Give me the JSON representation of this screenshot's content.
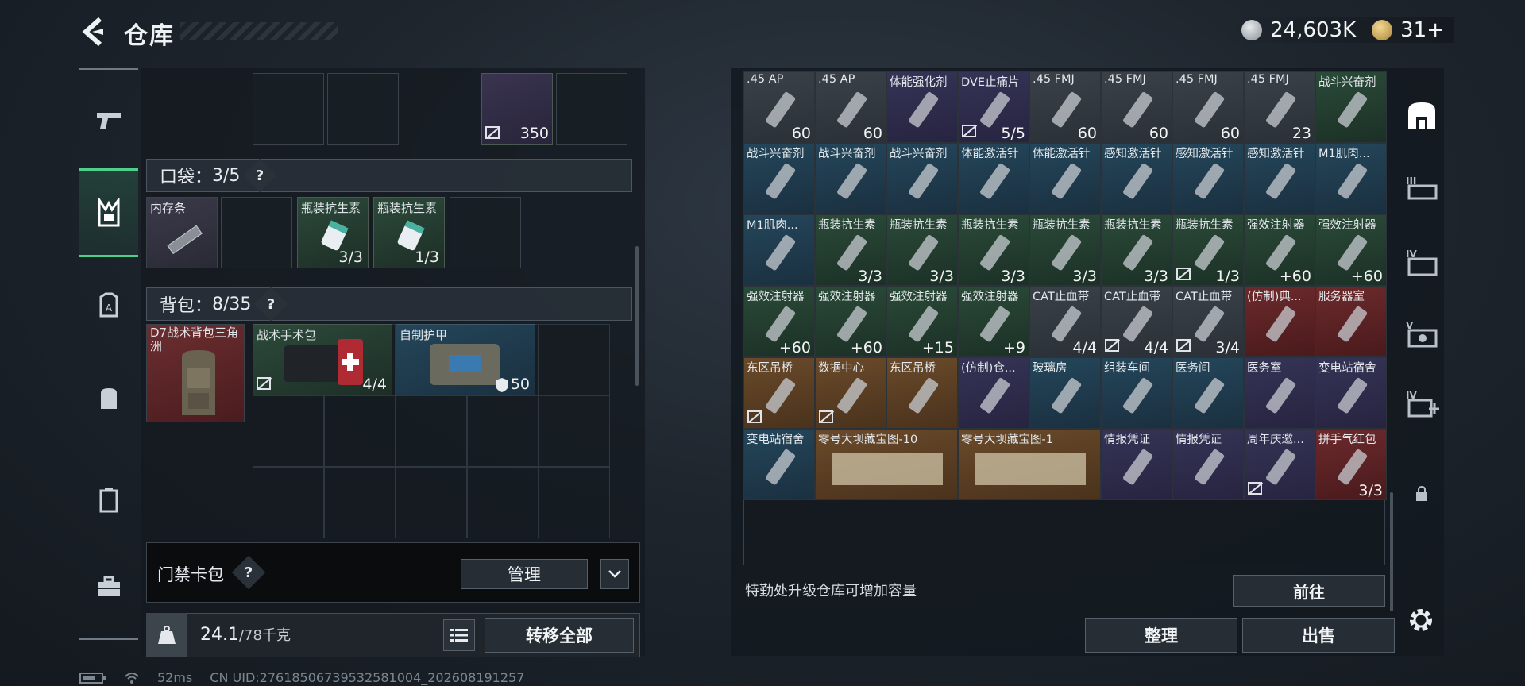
{
  "header": {
    "title": "仓库",
    "currency_1": "24,603K",
    "currency_2": "31+"
  },
  "left_nav": {
    "items": [
      "weapon-icon",
      "vest-icon",
      "armor-icon",
      "backpack-icon",
      "case-icon",
      "toolbox-icon"
    ]
  },
  "left_panel": {
    "top_slot_count": "350",
    "pocket": {
      "label": "口袋：",
      "used": "3",
      "total": "/5",
      "help": "?"
    },
    "pocket_items": [
      {
        "name": "内存条",
        "count": ""
      },
      {
        "name": "",
        "count": ""
      },
      {
        "name": "瓶装抗生素",
        "count": "3/3"
      },
      {
        "name": "瓶装抗生素",
        "count": "1/3"
      },
      {
        "name": "",
        "count": ""
      }
    ],
    "backpack": {
      "label": "背包：",
      "used": "8",
      "total": "/35",
      "help": "?"
    },
    "backpack_equipped": {
      "name": "D7战术背包三角洲"
    },
    "backpack_items": [
      {
        "name": "战术手术包",
        "count": "4/4"
      },
      {
        "name": "自制护甲",
        "count": "50"
      }
    ],
    "keycard": {
      "label": "门禁卡包",
      "help": "?",
      "manage": "管理"
    },
    "weight": {
      "value": "24.1",
      "max": "/78千克"
    },
    "transfer_all": "转移全部"
  },
  "status": {
    "ping": "52ms",
    "uid": "CN UID:2761850673953258100​4_202608191257"
  },
  "stash": {
    "rows": [
      [
        {
          "label": ".45 AP",
          "count": "60",
          "color": "c-gray"
        },
        {
          "label": ".45 AP",
          "count": "60",
          "color": "c-gray"
        },
        {
          "label": "体能强化剂",
          "count": "",
          "color": "c-purple"
        },
        {
          "label": "DVE止痛片",
          "count": "5/5",
          "color": "c-purple",
          "locked": true
        },
        {
          "label": ".45 FMJ",
          "count": "60",
          "color": "c-gray"
        },
        {
          "label": ".45 FMJ",
          "count": "60",
          "color": "c-gray"
        },
        {
          "label": ".45 FMJ",
          "count": "60",
          "color": "c-gray"
        },
        {
          "label": ".45 FMJ",
          "count": "23",
          "color": "c-gray"
        },
        {
          "label": "战斗兴奋剂",
          "count": "",
          "color": "c-green"
        }
      ],
      [
        {
          "label": "战斗兴奋剂",
          "count": "",
          "color": "c-blue"
        },
        {
          "label": "战斗兴奋剂",
          "count": "",
          "color": "c-blue"
        },
        {
          "label": "战斗兴奋剂",
          "count": "",
          "color": "c-blue"
        },
        {
          "label": "体能激活针",
          "count": "",
          "color": "c-blue"
        },
        {
          "label": "体能激活针",
          "count": "",
          "color": "c-blue"
        },
        {
          "label": "感知激活针",
          "count": "",
          "color": "c-blue"
        },
        {
          "label": "感知激活针",
          "count": "",
          "color": "c-blue"
        },
        {
          "label": "感知激活针",
          "count": "",
          "color": "c-blue"
        },
        {
          "label": "M1肌肉...",
          "count": "",
          "color": "c-blue"
        }
      ],
      [
        {
          "label": "M1肌肉...",
          "count": "",
          "color": "c-blue"
        },
        {
          "label": "瓶装抗生素",
          "count": "3/3",
          "color": "c-green"
        },
        {
          "label": "瓶装抗生素",
          "count": "3/3",
          "color": "c-green"
        },
        {
          "label": "瓶装抗生素",
          "count": "3/3",
          "color": "c-green"
        },
        {
          "label": "瓶装抗生素",
          "count": "3/3",
          "color": "c-green"
        },
        {
          "label": "瓶装抗生素",
          "count": "3/3",
          "color": "c-green"
        },
        {
          "label": "瓶装抗生素",
          "count": "1/3",
          "color": "c-green",
          "locked": true
        },
        {
          "label": "强效注射器",
          "count": "+60",
          "color": "c-green"
        },
        {
          "label": "强效注射器",
          "count": "+60",
          "color": "c-green"
        }
      ],
      [
        {
          "label": "强效注射器",
          "count": "+60",
          "color": "c-green"
        },
        {
          "label": "强效注射器",
          "count": "+60",
          "color": "c-green"
        },
        {
          "label": "强效注射器",
          "count": "+15",
          "color": "c-green"
        },
        {
          "label": "强效注射器",
          "count": "+9",
          "color": "c-green"
        },
        {
          "label": "CAT止血带",
          "count": "4/4",
          "color": "c-gray"
        },
        {
          "label": "CAT止血带",
          "count": "4/4",
          "color": "c-gray",
          "locked": true
        },
        {
          "label": "CAT止血带",
          "count": "3/4",
          "color": "c-gray",
          "locked": true
        },
        {
          "label": "(仿制)典...",
          "count": "",
          "color": "c-red"
        },
        {
          "label": "服务器室",
          "count": "",
          "color": "c-red"
        }
      ],
      [
        {
          "label": "东区吊桥",
          "count": "",
          "color": "c-gold",
          "locked": true
        },
        {
          "label": "数据中心",
          "count": "",
          "color": "c-gold",
          "locked": true
        },
        {
          "label": "东区吊桥",
          "count": "",
          "color": "c-gold"
        },
        {
          "label": "(仿制)仓...",
          "count": "",
          "color": "c-purple"
        },
        {
          "label": "玻璃房",
          "count": "",
          "color": "c-blue"
        },
        {
          "label": "组装车间",
          "count": "",
          "color": "c-blue"
        },
        {
          "label": "医务间",
          "count": "",
          "color": "c-blue"
        },
        {
          "label": "医务室",
          "count": "",
          "color": "c-purple"
        },
        {
          "label": "变电站宿舍",
          "count": "",
          "color": "c-purple"
        }
      ],
      [
        {
          "label": "变电站宿舍",
          "count": "",
          "color": "c-blue"
        },
        {
          "label": "零号大坝藏宝图-10",
          "count": "",
          "color": "c-gold",
          "wide": true
        },
        {
          "label": "零号大坝藏宝图-1",
          "count": "",
          "color": "c-gold",
          "wide": true
        },
        {
          "label": "情报凭证",
          "count": "",
          "color": "c-purple"
        },
        {
          "label": "情报凭证",
          "count": "",
          "color": "c-purple"
        },
        {
          "label": "周年庆邀...",
          "count": "",
          "color": "c-purple",
          "locked": true
        },
        {
          "label": "拼手气红包",
          "count": "3/3",
          "color": "c-red"
        }
      ]
    ],
    "upgrade_text": "特勤处升级仓库可增加容量",
    "goto": "前往",
    "sort": "整理",
    "sell": "出售"
  },
  "right_nav": {
    "items": [
      "I",
      "II",
      "III",
      "IV",
      "V",
      "IV+"
    ]
  }
}
